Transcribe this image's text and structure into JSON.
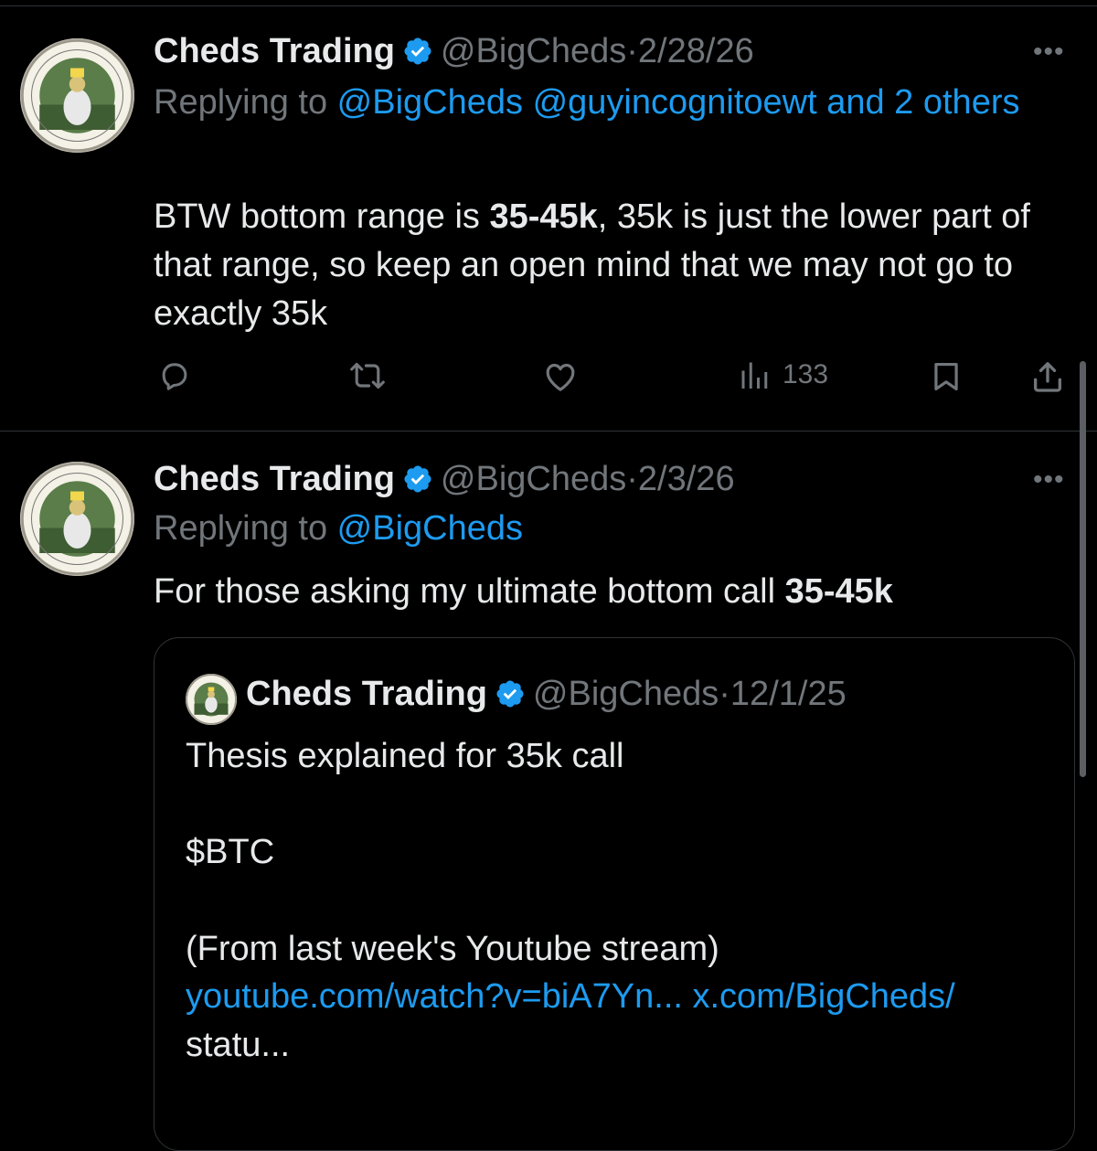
{
  "colors": {
    "background": "#000000",
    "text": "#e7e9ea",
    "muted": "#71767b",
    "link": "#1d9bf0",
    "verified": "#1d9bf0",
    "border": "#2f3336"
  },
  "tweet1": {
    "name": "Cheds Trading",
    "handle": "@BigCheds",
    "separator": "·",
    "date": "2/28/26",
    "more": "•••",
    "replying_prefix": "Replying to ",
    "replying_link": "@BigCheds @guyincognitoewt and 2 others",
    "text_1": "BTW bottom range is ",
    "text_bold": "35-45k",
    "text_2": ", 35k is just the lower part of that range, so keep an open mind that we may not go to exactly 35k",
    "views": "133"
  },
  "tweet2": {
    "name": "Cheds Trading",
    "handle": "@BigCheds",
    "separator": "·",
    "date": "2/3/26",
    "more": "•••",
    "replying_prefix": "Replying to ",
    "replying_link": "@BigCheds",
    "text_1": "For those asking my ultimate bottom call ",
    "text_bold": "35-45k"
  },
  "quoted": {
    "name": "Cheds Trading",
    "handle": "@BigCheds",
    "separator": "·",
    "date": "12/1/25",
    "line1": "Thesis explained for 35k call",
    "cashtag": "$BTC",
    "line3": "(From last week's Youtube stream)",
    "link1": "youtube.com/watch?v=biA7Yn...",
    "link2": "x.com/BigCheds/",
    "link3": "statu..."
  },
  "icons": [
    "reply-icon",
    "retweet-icon",
    "like-icon",
    "views-icon",
    "bookmark-icon",
    "share-icon",
    "verified-icon",
    "more-icon"
  ]
}
